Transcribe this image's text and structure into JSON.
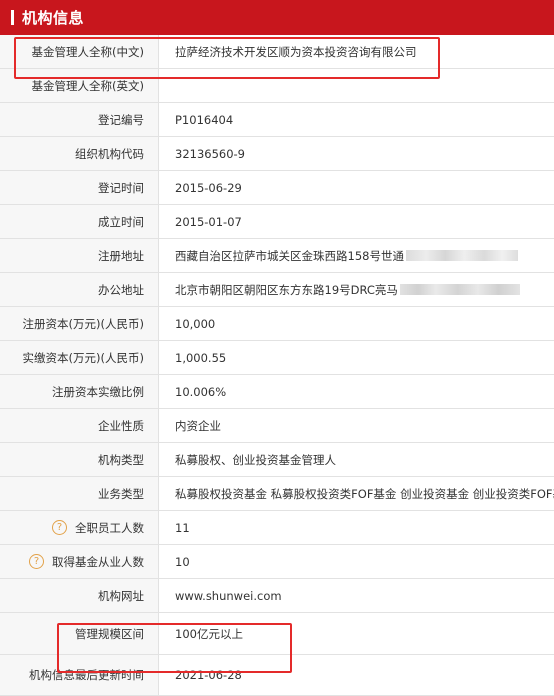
{
  "header": {
    "title": "机构信息"
  },
  "rows": [
    {
      "label": "基金管理人全称(中文)",
      "value": "拉萨经济技术开发区顺为资本投资咨询有限公司"
    },
    {
      "label": "基金管理人全称(英文)",
      "value": ""
    },
    {
      "label": "登记编号",
      "value": "P1016404"
    },
    {
      "label": "组织机构代码",
      "value": "32136560-9"
    },
    {
      "label": "登记时间",
      "value": "2015-06-29"
    },
    {
      "label": "成立时间",
      "value": "2015-01-07"
    },
    {
      "label": "注册地址",
      "value": "西藏自治区拉萨市城关区金珠西路158号世通"
    },
    {
      "label": "办公地址",
      "value": "北京市朝阳区朝阳区东方东路19号DRC亮马"
    },
    {
      "label": "注册资本(万元)(人民币)",
      "value": "10,000"
    },
    {
      "label": "实缴资本(万元)(人民币)",
      "value": "1,000.55"
    },
    {
      "label": "注册资本实缴比例",
      "value": "10.006%"
    },
    {
      "label": "企业性质",
      "value": "内资企业"
    },
    {
      "label": "机构类型",
      "value": "私募股权、创业投资基金管理人"
    },
    {
      "label": "业务类型",
      "value": "私募股权投资基金  私募股权投资类FOF基金  创业投资基金  创业投资类FOF基金"
    },
    {
      "label": "全职员工人数",
      "value": "11",
      "help": "?"
    },
    {
      "label": "取得基金从业人数",
      "value": "10",
      "help": "?"
    },
    {
      "label": "机构网址",
      "value": "www.shunwei.com"
    },
    {
      "label": "管理规模区间",
      "value": "100亿元以上"
    },
    {
      "label": "机构信息最后更新时间",
      "value": "2021-06-28"
    }
  ]
}
